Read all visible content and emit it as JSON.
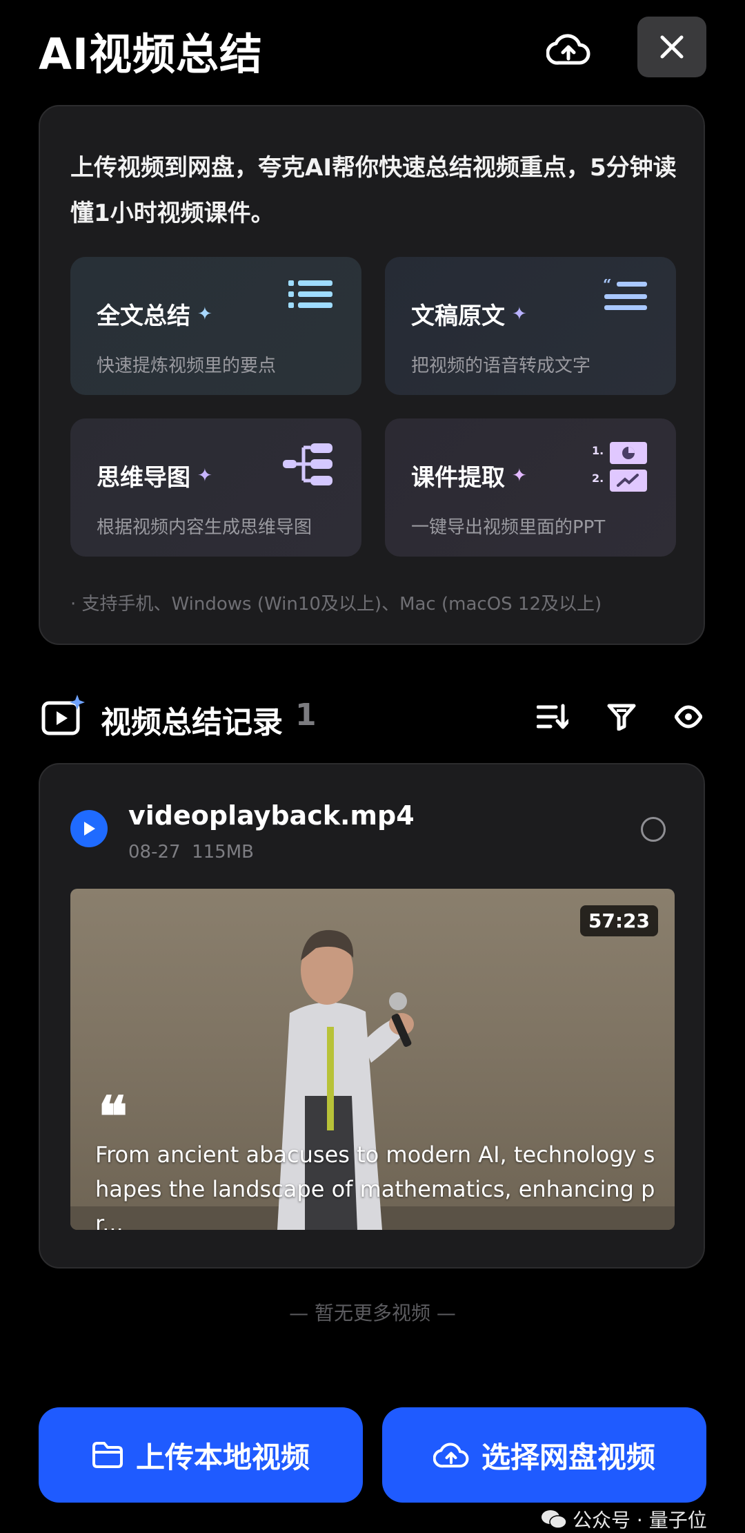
{
  "header": {
    "title": "AI视频总结"
  },
  "intro": {
    "text": "上传视频到网盘，夸克AI帮你快速总结视频重点，5分钟读懂1小时视频课件。",
    "features": [
      {
        "title": "全文总结",
        "desc": "快速提炼视频里的要点",
        "icon": "list-icon"
      },
      {
        "title": "文稿原文",
        "desc": "把视频的语音转成文字",
        "icon": "quote-list-icon"
      },
      {
        "title": "思维导图",
        "desc": "根据视频内容生成思维导图",
        "icon": "mindmap-icon"
      },
      {
        "title": "课件提取",
        "desc": "一键导出视频里面的PPT",
        "icon": "slides-icon"
      }
    ],
    "support": "· 支持手机、Windows (Win10及以上)、Mac (macOS 12及以上)",
    "slide_numbers": [
      "1.",
      "2."
    ]
  },
  "records": {
    "title": "视频总结记录",
    "count": "1"
  },
  "video": {
    "name": "videoplayback.mp4",
    "meta": "08-27  115MB",
    "duration": "57:23",
    "quote": "From ancient abacuses to modern AI, technology shapes the landscape of mathematics, enhancing pr..."
  },
  "footer": {
    "no_more": "— 暂无更多视频 —",
    "upload_label": "上传本地视频",
    "cloud_label": "选择网盘视频"
  },
  "watermark": {
    "text": "公众号 · 量子位"
  },
  "colors": {
    "accent": "#1f5bff",
    "background": "#000000",
    "card": "#1c1c1e",
    "sparkle": "#a8d8ff"
  }
}
